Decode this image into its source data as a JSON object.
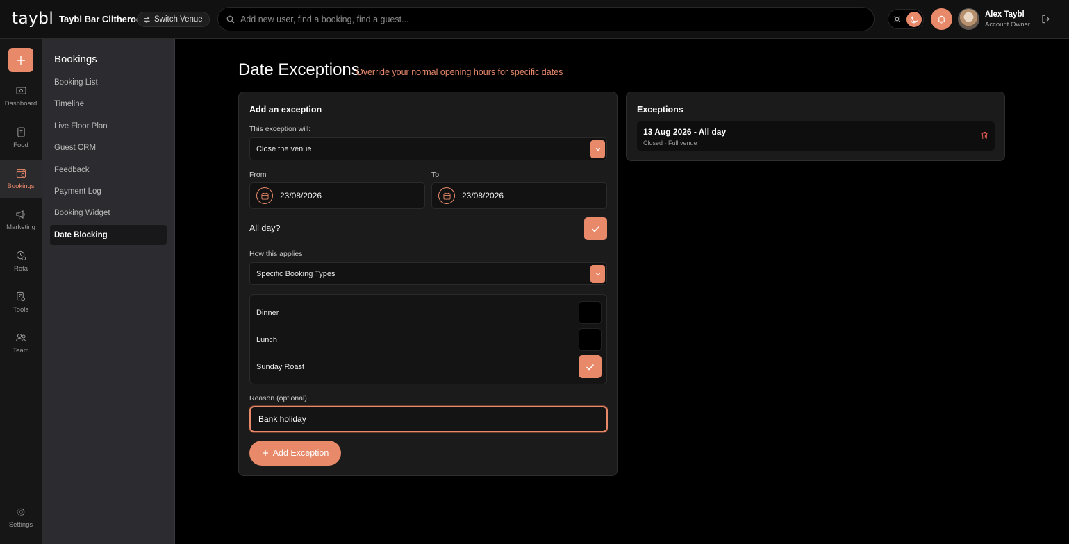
{
  "colors": {
    "accent": "#e8896a",
    "background": "#000000",
    "panel": "#1b1b1b"
  },
  "header": {
    "logo": "taybl",
    "venue_name": "Taybl Bar Clitheroe",
    "switch_venue_label": "Switch Venue",
    "search_placeholder": "Add new user, find a booking, find a guest...",
    "user": {
      "name": "Alex Taybl",
      "role": "Account Owner"
    },
    "icons": [
      "sun-icon",
      "moon-icon",
      "bell-icon",
      "logout-icon"
    ]
  },
  "rail": {
    "items": [
      {
        "label": "Dashboard",
        "icon": "dashboard-icon",
        "active": false
      },
      {
        "label": "Food",
        "icon": "food-icon",
        "active": false
      },
      {
        "label": "Bookings",
        "icon": "bookings-icon",
        "active": true
      },
      {
        "label": "Marketing",
        "icon": "megaphone-icon",
        "active": false
      },
      {
        "label": "Rota",
        "icon": "rota-icon",
        "active": false
      },
      {
        "label": "Tools",
        "icon": "tools-icon",
        "active": false
      },
      {
        "label": "Team",
        "icon": "team-icon",
        "active": false
      }
    ],
    "settings_label": "Settings"
  },
  "sidebar": {
    "title": "Bookings",
    "items": [
      {
        "label": "Booking List",
        "active": false
      },
      {
        "label": "Timeline",
        "active": false
      },
      {
        "label": "Live Floor Plan",
        "active": false
      },
      {
        "label": "Guest CRM",
        "active": false
      },
      {
        "label": "Feedback",
        "active": false
      },
      {
        "label": "Payment Log",
        "active": false
      },
      {
        "label": "Booking Widget",
        "active": false
      },
      {
        "label": "Date Blocking",
        "active": true
      }
    ]
  },
  "page": {
    "title": "Date Exceptions",
    "subtitle": "Override your normal opening hours for specific dates"
  },
  "form": {
    "title": "Add an exception",
    "exception_label": "This exception will:",
    "exception_value": "Close the venue",
    "from_label": "From",
    "from_value": "23/08/2026",
    "to_label": "To",
    "to_value": "23/08/2026",
    "all_day_label": "All day?",
    "all_day_checked": true,
    "applies_label": "How this applies",
    "applies_value": "Specific Booking Types",
    "booking_types": [
      {
        "label": "Dinner",
        "checked": false
      },
      {
        "label": "Lunch",
        "checked": false
      },
      {
        "label": "Sunday Roast",
        "checked": true
      }
    ],
    "reason_label": "Reason (optional)",
    "reason_value": "Bank holiday",
    "add_button_label": "Add Exception"
  },
  "exceptions": {
    "title": "Exceptions",
    "items": [
      {
        "title": "13 Aug 2026 - All day",
        "subtitle": "Closed · Full venue"
      }
    ]
  }
}
